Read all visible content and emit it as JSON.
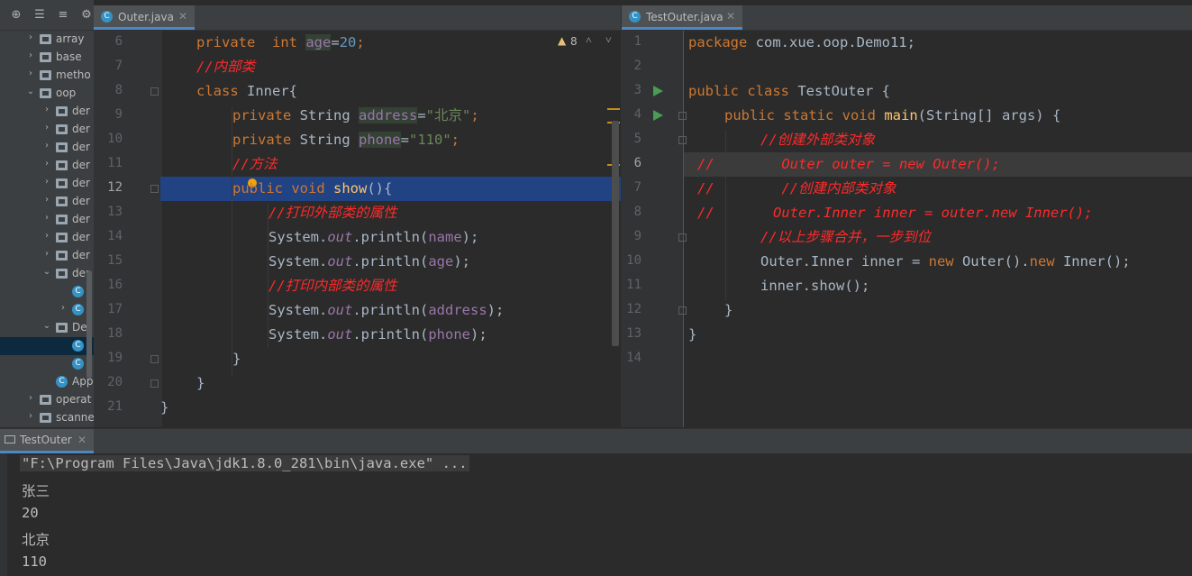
{
  "project_tree": [
    {
      "label": "array",
      "chev": "›",
      "type": "folder",
      "indent": 0
    },
    {
      "label": "base",
      "chev": "›",
      "type": "folder",
      "indent": 0
    },
    {
      "label": "metho",
      "chev": "›",
      "type": "folder",
      "indent": 0
    },
    {
      "label": "oop",
      "chev": "⌄",
      "type": "folder",
      "indent": 0
    },
    {
      "label": "der",
      "chev": "›",
      "type": "folder",
      "indent": 1
    },
    {
      "label": "der",
      "chev": "›",
      "type": "folder",
      "indent": 1
    },
    {
      "label": "der",
      "chev": "›",
      "type": "folder",
      "indent": 1
    },
    {
      "label": "der",
      "chev": "›",
      "type": "folder",
      "indent": 1
    },
    {
      "label": "der",
      "chev": "›",
      "type": "folder",
      "indent": 1
    },
    {
      "label": "der",
      "chev": "›",
      "type": "folder",
      "indent": 1
    },
    {
      "label": "der",
      "chev": "›",
      "type": "folder",
      "indent": 1
    },
    {
      "label": "der",
      "chev": "›",
      "type": "folder",
      "indent": 1
    },
    {
      "label": "der",
      "chev": "›",
      "type": "folder",
      "indent": 1
    },
    {
      "label": "der",
      "chev": "⌄",
      "type": "folder",
      "indent": 1
    },
    {
      "label": "",
      "chev": "",
      "type": "class",
      "indent": 2
    },
    {
      "label": "",
      "chev": "›",
      "type": "class",
      "indent": 2
    },
    {
      "label": "De",
      "chev": "⌄",
      "type": "folder",
      "indent": 1
    },
    {
      "label": "",
      "chev": "",
      "type": "class",
      "indent": 2,
      "selected": true
    },
    {
      "label": "",
      "chev": "",
      "type": "class",
      "indent": 2
    },
    {
      "label": "App",
      "chev": "",
      "type": "class",
      "indent": 1
    },
    {
      "label": "operat",
      "chev": "›",
      "type": "folder",
      "indent": 0
    },
    {
      "label": "scanne",
      "chev": "›",
      "type": "folder",
      "indent": 0
    }
  ],
  "tabs": {
    "left": {
      "label": "Outer.java"
    },
    "right": {
      "label": "TestOuter.java"
    }
  },
  "left_editor": {
    "inspection_count": "8",
    "line_numbers": [
      "6",
      "7",
      "8",
      "9",
      "10",
      "11",
      "12",
      "13",
      "14",
      "15",
      "16",
      "17",
      "18",
      "19",
      "20",
      "21"
    ],
    "current_line": "12"
  },
  "right_editor": {
    "line_numbers": [
      "1",
      "2",
      "3",
      "4",
      "5",
      "6",
      "7",
      "8",
      "9",
      "10",
      "11",
      "12",
      "13",
      "14"
    ],
    "current_line": "6"
  },
  "left_code": {
    "l6": {
      "a": "private",
      "b": "int",
      "c": "age",
      "d": "=",
      "e": "20",
      "f": ";"
    },
    "l7": {
      "a": "//内部类"
    },
    "l8": {
      "a": "class",
      "b": " Inner{"
    },
    "l9": {
      "a": "private",
      "b": " String ",
      "c": "address",
      "d": "=",
      "e": "\"北京\"",
      "f": ";"
    },
    "l10": {
      "a": "private",
      "b": " String ",
      "c": "phone",
      "d": "=",
      "e": "\"110\"",
      "f": ";"
    },
    "l11": {
      "a": "//方法"
    },
    "l12": {
      "a": "public",
      "b": " void ",
      "c": "show",
      "d": "(){"
    },
    "l13": {
      "a": "//打印外部类的属性"
    },
    "l14": {
      "a": "System.",
      "b": "out",
      "c": ".println(",
      "d": "name",
      "e": ");"
    },
    "l15": {
      "a": "System.",
      "b": "out",
      "c": ".println(",
      "d": "age",
      "e": ");"
    },
    "l16": {
      "a": "//打印内部类的属性"
    },
    "l17": {
      "a": "System.",
      "b": "out",
      "c": ".println(",
      "d": "address",
      "e": ");"
    },
    "l18": {
      "a": "System.",
      "b": "out",
      "c": ".println(",
      "d": "phone",
      "e": ");"
    },
    "l19": {
      "a": "}"
    },
    "l20": {
      "a": "}"
    },
    "l21": {
      "a": "}"
    }
  },
  "right_code": {
    "l1": {
      "a": "package",
      "b": " com.xue.oop.Demo11;"
    },
    "l3": {
      "a": "public class",
      "b": " TestOuter {"
    },
    "l4": {
      "a": "public static void",
      "b": " ",
      "c": "main",
      "d": "(String[] args) {"
    },
    "l5": {
      "a": "//创建外部类对象"
    },
    "l6": {
      "a": "//        Outer outer = new Outer();"
    },
    "l7": {
      "a": "//        //创建内部类对象"
    },
    "l8": {
      "a": "//       Outer.Inner inner = outer.new Inner();"
    },
    "l9": {
      "a": "//以上步骤合并，一步到位"
    },
    "l10": {
      "a": "Outer.Inner inner = ",
      "b": "new",
      "c": " Outer().",
      "d": "new",
      "e": " Inner();"
    },
    "l11": {
      "a": "inner.show();"
    },
    "l12": {
      "a": "}"
    },
    "l13": {
      "a": "}"
    }
  },
  "run_panel": {
    "tab_label": "TestOuter",
    "output": [
      "\"F:\\Program Files\\Java\\jdk1.8.0_281\\bin\\java.exe\" ...",
      "张三",
      "20",
      "北京",
      "110"
    ]
  }
}
